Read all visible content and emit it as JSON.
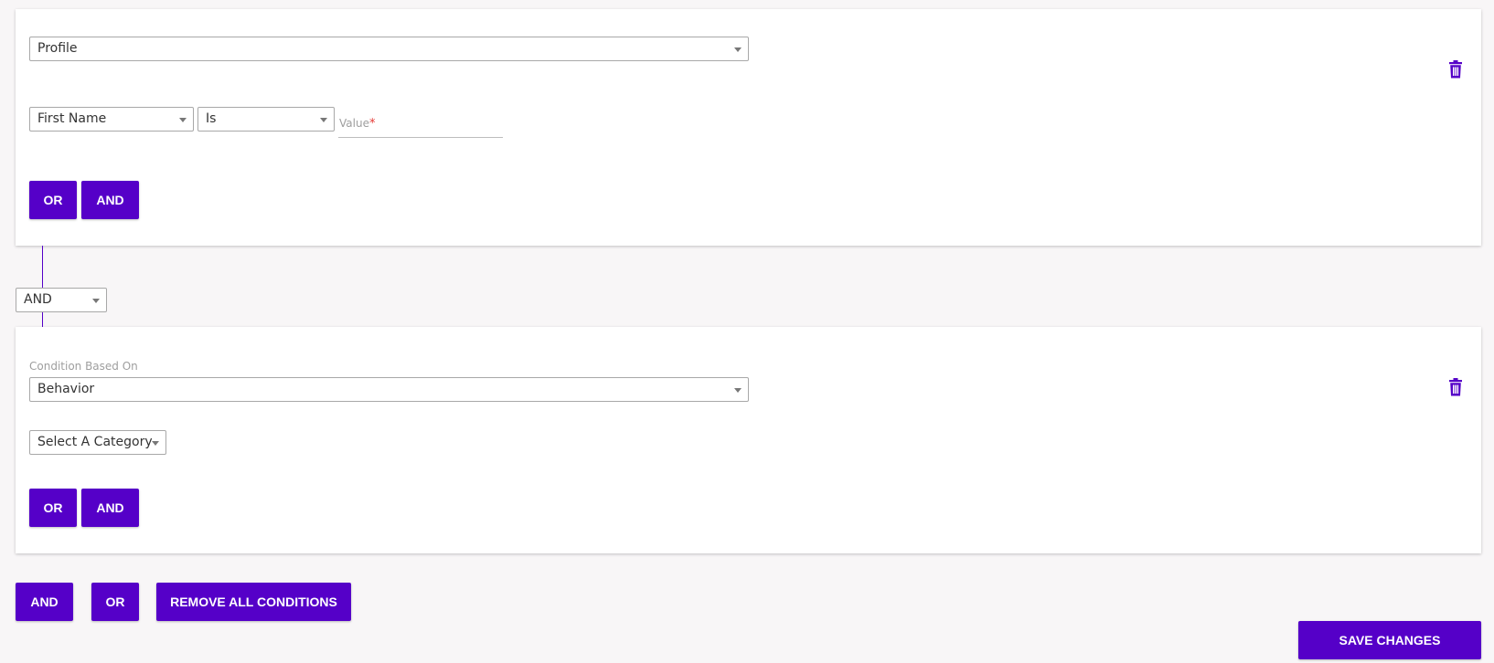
{
  "theme": {
    "accent": "#5500c8",
    "background": "#f8f6f7",
    "required": "#e53935"
  },
  "condition1": {
    "based_on_value": "Profile",
    "field_value": "First Name",
    "operator_value": "Is",
    "value_label": "Value",
    "value_required_mark": "*",
    "or_label": "OR",
    "and_label": "AND",
    "delete_icon": "trash-icon"
  },
  "connector": {
    "value": "AND"
  },
  "condition2": {
    "based_on_label": "Condition Based On",
    "based_on_value": "Behavior",
    "category_value": "Select A Category",
    "or_label": "OR",
    "and_label": "AND",
    "delete_icon": "trash-icon"
  },
  "footer": {
    "and_label": "AND",
    "or_label": "OR",
    "remove_all_label": "REMOVE ALL CONDITIONS",
    "save_label": "SAVE CHANGES"
  }
}
